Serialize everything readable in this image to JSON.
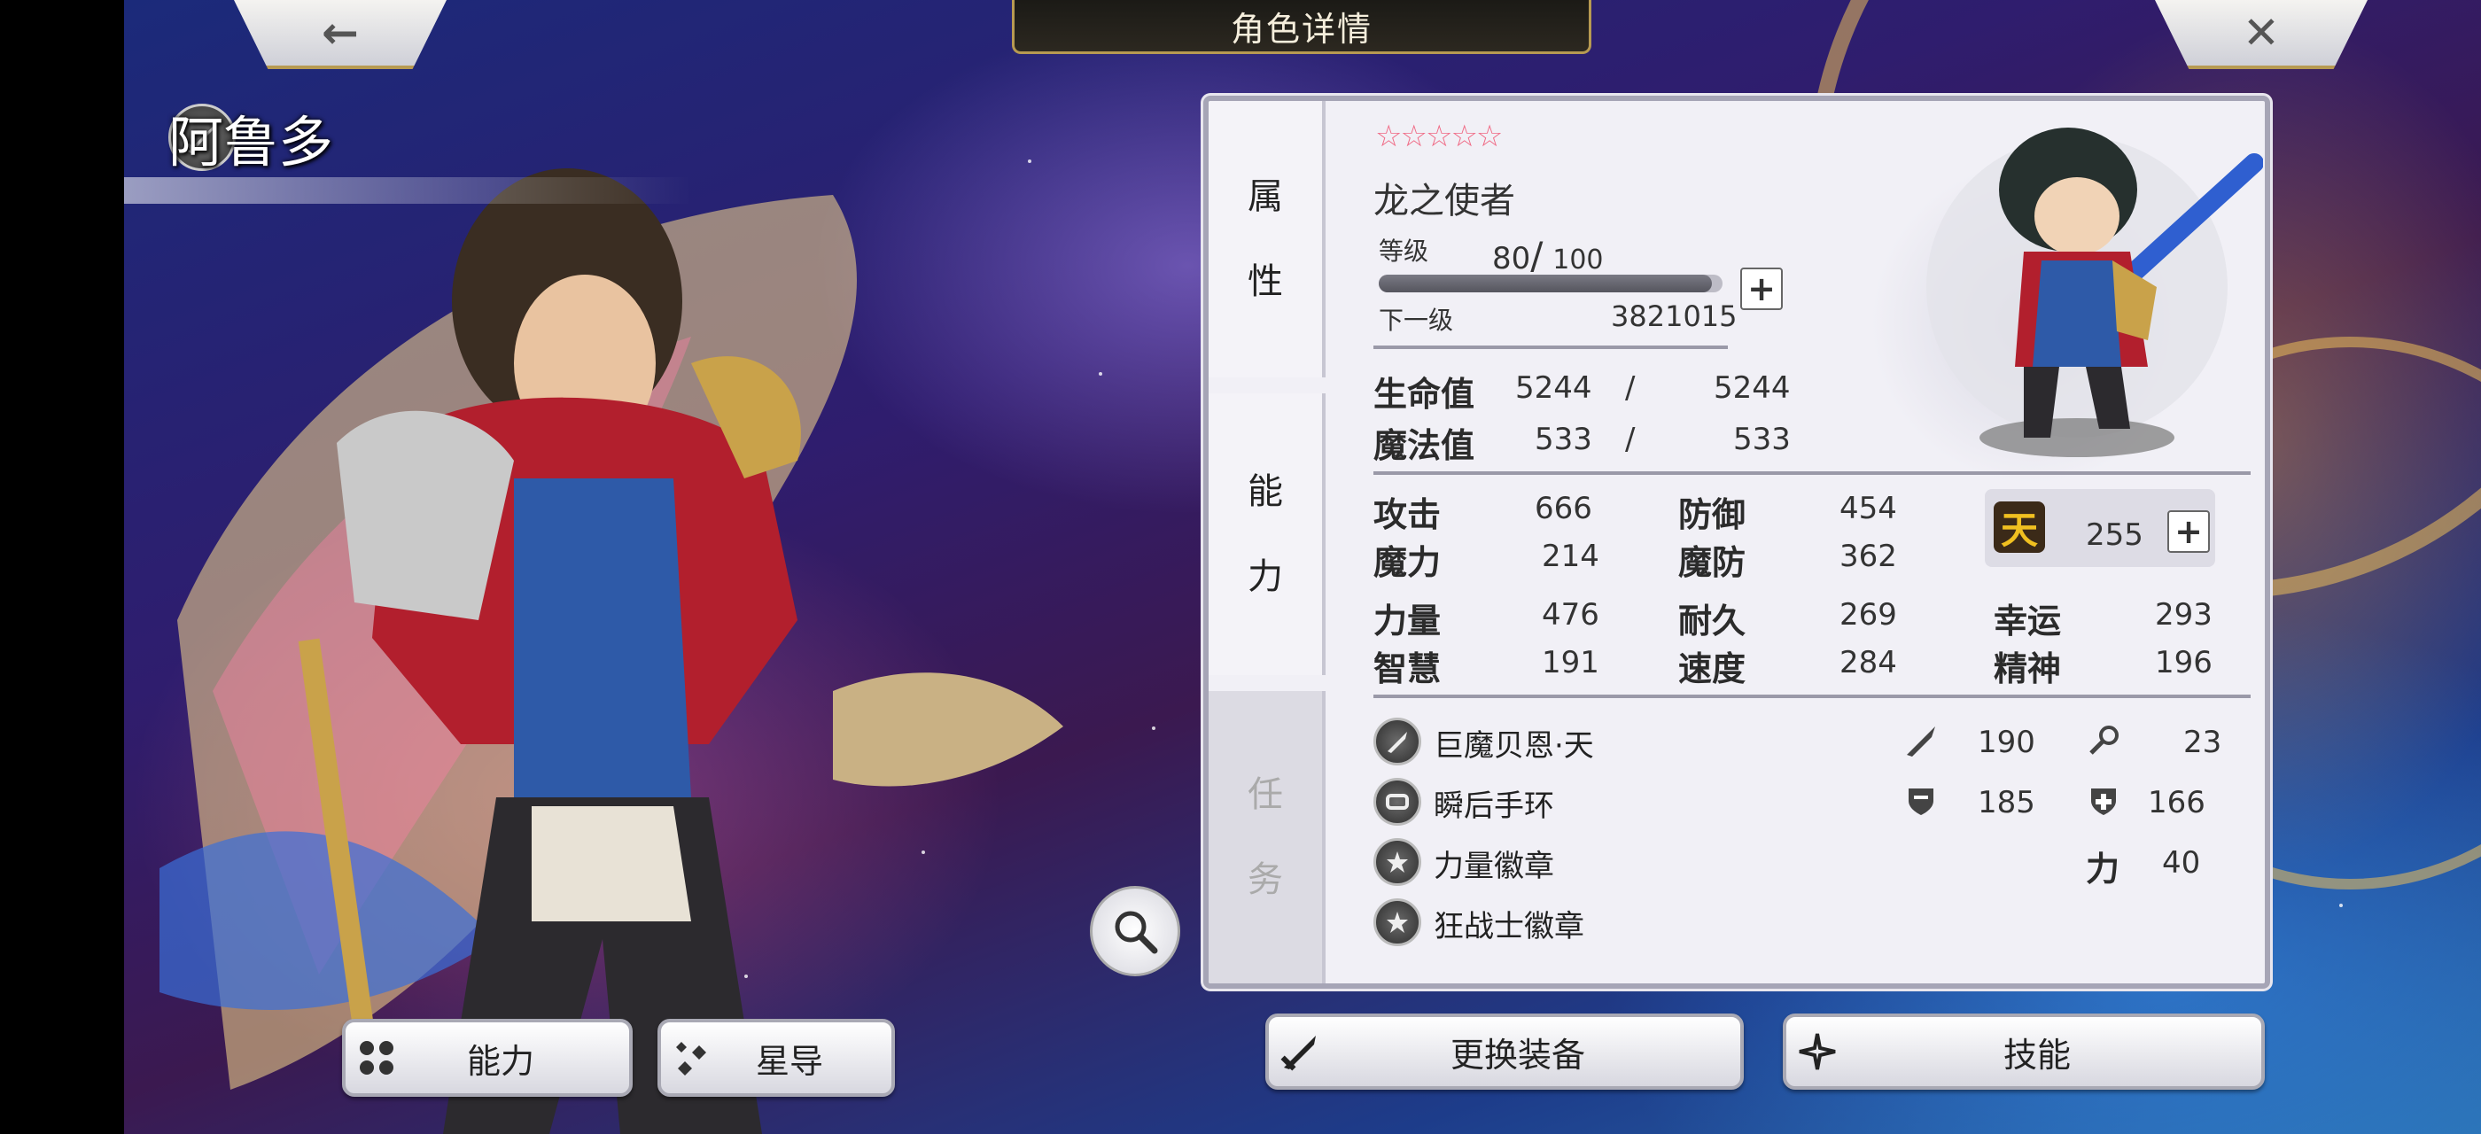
{
  "header": {
    "title": "角色详情",
    "back_icon": "back-arrow-icon",
    "close_icon": "close-icon"
  },
  "character": {
    "name": "阿鲁多",
    "class_icon": "sword-class-icon"
  },
  "tabs": [
    {
      "label_1": "属",
      "label_2": "性",
      "active": true
    },
    {
      "label_1": "能",
      "label_2": "力",
      "active": true
    },
    {
      "label_1": "任",
      "label_2": "务",
      "active": false
    }
  ],
  "profile": {
    "rarity_stars": 5,
    "title": "龙之使者",
    "level_label": "等级",
    "level": "80",
    "level_max": "100",
    "next_label": "下一级",
    "next_exp": "3821015",
    "exp_progress": 0.97
  },
  "vitals": [
    {
      "label": "生命值",
      "current": "5244",
      "sep": "/",
      "max": "5244"
    },
    {
      "label": "魔法值",
      "current": "533",
      "sep": "/",
      "max": "533"
    }
  ],
  "stats": {
    "attack": {
      "label": "攻击",
      "value": "666"
    },
    "defense": {
      "label": "防御",
      "value": "454"
    },
    "magic": {
      "label": "魔力",
      "value": "214"
    },
    "magic_def": {
      "label": "魔防",
      "value": "362"
    },
    "strength": {
      "label": "力量",
      "value": "476"
    },
    "endurance": {
      "label": "耐久",
      "value": "269"
    },
    "luck": {
      "label": "幸运",
      "value": "293"
    },
    "wisdom": {
      "label": "智慧",
      "value": "191"
    },
    "speed": {
      "label": "速度",
      "value": "284"
    },
    "spirit": {
      "label": "精神",
      "value": "196"
    },
    "heaven": {
      "badge": "天",
      "value": "255"
    }
  },
  "equipment": [
    {
      "name": "巨魔贝恩·天",
      "icon": "sword-icon"
    },
    {
      "name": "瞬后手环",
      "icon": "bracelet-icon"
    },
    {
      "name": "力量徽章",
      "icon": "star-badge-icon"
    },
    {
      "name": "狂战士徽章",
      "icon": "star-badge-icon"
    }
  ],
  "equip_bonus": {
    "atk": "190",
    "matk": "23",
    "def": "185",
    "mdef": "166",
    "str_label": "力",
    "str": "40"
  },
  "buttons": {
    "ability": "能力",
    "star_guide": "星导",
    "change_equip": "更换装备",
    "skills": "技能"
  },
  "colors": {
    "panel_border": "#a6a5b6",
    "star": "#f06a85",
    "heaven_badge": "#f0c020",
    "frame_gold": "#b79a52"
  }
}
